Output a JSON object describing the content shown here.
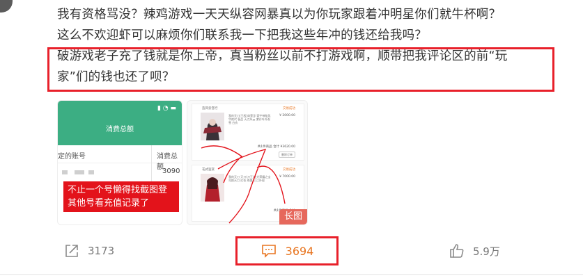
{
  "post": {
    "lines": [
      "我有资格骂没？辣鸡游戏一天天纵容网暴真以为你玩家跟着冲明星你们就牛杯啊？",
      "这么不欢迎虾可以麻烦你们联系我一下把我这些年冲的钱还给我吗？",
      "破游戏老子充了钱就是你上帝，真当粉丝以前不打游戏啊，顺带把我评论区的前“玩",
      "家”们的钱也还了呗？"
    ]
  },
  "thumb1": {
    "status": "▮ ◔ ▬",
    "title": "消费总额",
    "row_label": "定的账号",
    "row_header": "消费总额",
    "row_value": "3090",
    "caption_lines": [
      "不止一个号懒得找截图登",
      "其他号看充值记录了"
    ]
  },
  "thumb2": {
    "badge": "长图",
    "cards": [
      {
        "shop": "造风云音行",
        "status": "交易成功",
        "desc": "我的天刀(王权)商荣华 寰宇神秘风华绝代 极品 天刀风云 紫衫叶外观 雪 白衣",
        "price": "¥ 2000.00",
        "total": "共1件商品 合计 ¥3620.00",
        "btn": "删除订单"
      },
      {
        "shop": "花式鉴赏",
        "status": "交易成功",
        "desc": "我的天刀 天刀(刀王)金光荣耀之宝 兑换天刀 红衣 绝美 三江外观",
        "price": "¥ 7000.00",
        "total": "共1件商品 合计",
        "btn": ""
      }
    ]
  },
  "actions": {
    "repost_count": "3173",
    "comment_count": "3694",
    "like_count": "5.9万"
  },
  "colors": {
    "highlight_red": "#e8202a",
    "accent_orange": "#e87520",
    "header_green": "#3cae83"
  },
  "icons": [
    "share-icon",
    "comment-icon",
    "thumbs-up-icon"
  ]
}
